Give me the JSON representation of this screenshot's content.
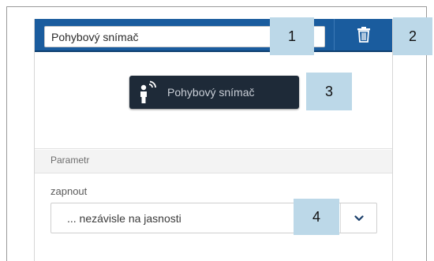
{
  "sensor": {
    "name_value": "Pohybový snímač",
    "button_label": "Pohybový snímač"
  },
  "icons": {
    "delete": "trash-icon",
    "device": "motion-sensor-icon",
    "dropdown": "chevron-down-icon"
  },
  "parameters": {
    "section_title": "Parametr",
    "switch_on_label": "zapnout",
    "switch_on_value": "... nezávisle na jasnosti"
  },
  "callouts": [
    "1",
    "2",
    "3",
    "4"
  ],
  "colors": {
    "header_blue": "#1a5c9e",
    "device_button": "#1e2a38",
    "callout": "#bcd8e8"
  }
}
